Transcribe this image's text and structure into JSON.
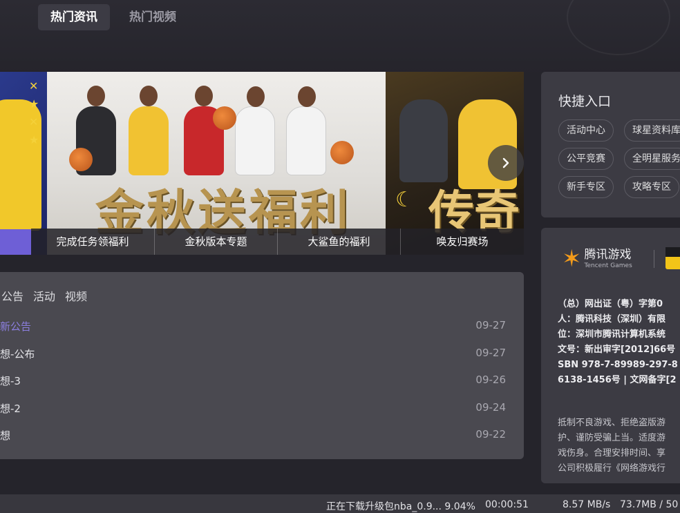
{
  "top_tabs": [
    {
      "label": "热门资讯",
      "active": true
    },
    {
      "label": "热门视频",
      "active": false
    }
  ],
  "banner": {
    "slide_title": "金秋送福利",
    "slide_right_text": "传奇",
    "captions": [
      "完成任务领福利",
      "金秋版本专题",
      "大鲨鱼的福利",
      "唤友归赛场"
    ],
    "next_icon": "chevron-right-icon"
  },
  "news": {
    "tabs": [
      "公告",
      "活动",
      "视频"
    ],
    "items": [
      {
        "title": "新公告",
        "date": "09-27",
        "highlight": true
      },
      {
        "title": "想-公布",
        "date": "09-27"
      },
      {
        "title": "想-3",
        "date": "09-26"
      },
      {
        "title": "想-2",
        "date": "09-24"
      },
      {
        "title": "想",
        "date": "09-22"
      }
    ]
  },
  "quick_entry": {
    "title": "快捷入口",
    "items": [
      "活动中心",
      "球星资料库",
      "公平竞赛",
      "全明星服务",
      "新手专区",
      "攻略专区"
    ]
  },
  "publisher": {
    "logo_cn": "腾讯游戏",
    "logo_en": "Tencent Games",
    "lines": [
      "（总）网出证（粤）字第0",
      "人：腾讯科技（深圳）有限",
      "位：深圳市腾讯计算机系统",
      "文号：新出审字[2012]66号",
      "SBN 978-7-89989-297-8",
      "6138-1456号 | 文网备字[2"
    ],
    "warning_lines": [
      "抵制不良游戏、拒绝盗版游",
      "护、谨防受骗上当。适度游",
      "戏伤身。合理安排时间、享",
      "公司积极履行《网络游戏行"
    ]
  },
  "status": {
    "download_text": "正在下载升级包nba_0.9... 9.04%",
    "time": "00:00:51",
    "speed": "8.57 MB/s",
    "size": "73.7MB / 50"
  },
  "colors": {
    "background": "#25242b",
    "panel": "#3c3b43",
    "news_panel": "#4a4950",
    "highlight": "#8c7fe0",
    "tab_active": "#3c3b44"
  }
}
